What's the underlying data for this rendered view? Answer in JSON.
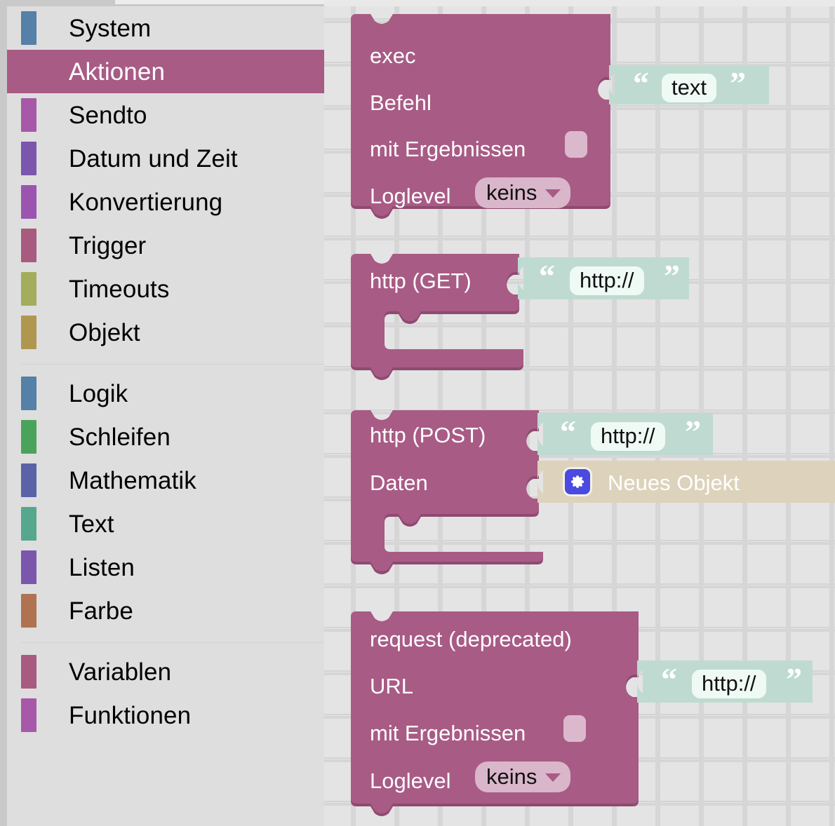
{
  "app": {
    "editor": "blockly-workspace",
    "colors": {
      "action_block": "#a85b85",
      "action_block_shadow": "#8f4a70",
      "string_block": "#bfdbd1",
      "object_block": "#ddd2bb",
      "sidebar_bg": "#dedede",
      "canvas_bg": "#e4e4e4",
      "selected_row": "#a85b85",
      "gear_chip": "#4a4ae0"
    }
  },
  "sidebar": {
    "groups": [
      {
        "items": [
          {
            "label": "System",
            "color": "#5580a8",
            "selected": false
          },
          {
            "label": "Aktionen",
            "color": "#a85b85",
            "selected": true
          },
          {
            "label": "Sendto",
            "color": "#a858a8",
            "selected": false
          },
          {
            "label": "Datum und Zeit",
            "color": "#7b56ad",
            "selected": false
          },
          {
            "label": "Konvertierung",
            "color": "#9b55b0",
            "selected": false
          },
          {
            "label": "Trigger",
            "color": "#a85b7e",
            "selected": false
          },
          {
            "label": "Timeouts",
            "color": "#a3ad5c",
            "selected": false
          },
          {
            "label": "Objekt",
            "color": "#b0974f",
            "selected": false
          }
        ]
      },
      {
        "items": [
          {
            "label": "Logik",
            "color": "#5580a8",
            "selected": false
          },
          {
            "label": "Schleifen",
            "color": "#4aa35a",
            "selected": false
          },
          {
            "label": "Mathematik",
            "color": "#5a62a8",
            "selected": false
          },
          {
            "label": "Text",
            "color": "#55a88e",
            "selected": false
          },
          {
            "label": "Listen",
            "color": "#7b56ad",
            "selected": false
          },
          {
            "label": "Farbe",
            "color": "#b07351",
            "selected": false
          }
        ]
      },
      {
        "items": [
          {
            "label": "Variablen",
            "color": "#a85b7e",
            "selected": false
          },
          {
            "label": "Funktionen",
            "color": "#a858a8",
            "selected": false
          }
        ]
      }
    ]
  },
  "blocks": [
    {
      "id": "exec",
      "title": "exec",
      "rows": [
        {
          "label": "Befehl"
        },
        {
          "label": "mit Ergebnissen",
          "checkbox": {
            "checked": false
          }
        },
        {
          "label": "Loglevel",
          "dropdown": {
            "value": "keins"
          }
        }
      ],
      "attached": [
        {
          "type": "string",
          "value": "text",
          "open_quote": "“",
          "close_quote": "”"
        }
      ]
    },
    {
      "id": "http-get",
      "title": "http (GET)",
      "rows": [],
      "attached": [
        {
          "type": "string",
          "value": "http://",
          "open_quote": "“",
          "close_quote": "”"
        }
      ]
    },
    {
      "id": "http-post",
      "title": "http (POST)",
      "rows": [
        {
          "label": "Daten"
        }
      ],
      "attached": [
        {
          "type": "string",
          "value": "http://",
          "open_quote": "“",
          "close_quote": "”"
        },
        {
          "type": "object",
          "value": "Neues Objekt",
          "icon": "gear-icon"
        }
      ]
    },
    {
      "id": "request-deprecated",
      "title": "request (deprecated)",
      "rows": [
        {
          "label": "URL"
        },
        {
          "label": "mit Ergebnissen",
          "checkbox": {
            "checked": false
          }
        },
        {
          "label": "Loglevel",
          "dropdown": {
            "value": "keins"
          }
        }
      ],
      "attached": [
        {
          "type": "string",
          "value": "http://",
          "open_quote": "“",
          "close_quote": "”"
        }
      ]
    }
  ]
}
